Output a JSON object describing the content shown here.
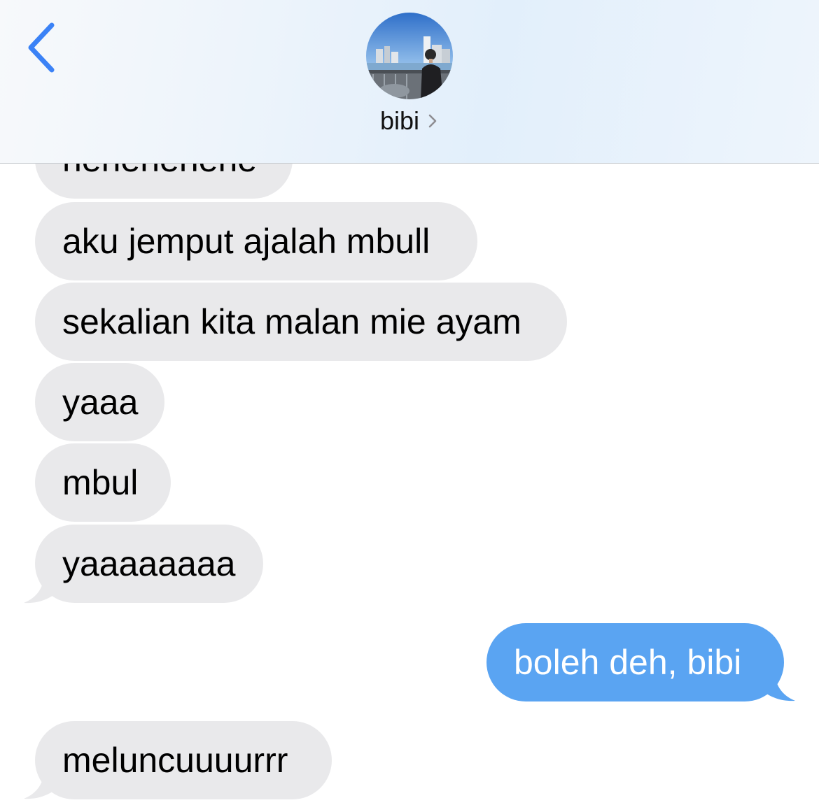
{
  "conversation": {
    "contact_name": "bibi",
    "back_icon": "chevron-left-icon",
    "contact_chevron_icon": "chevron-right-icon",
    "accent_color": "#3b82f6",
    "messages": [
      {
        "from": "them",
        "text": "hehehehehe"
      },
      {
        "from": "them",
        "text": "aku jemput ajalah mbull"
      },
      {
        "from": "them",
        "text": "sekalian kita malan mie ayam"
      },
      {
        "from": "them",
        "text": "yaaa"
      },
      {
        "from": "them",
        "text": "mbul"
      },
      {
        "from": "them",
        "text": "yaaaaaaaa"
      },
      {
        "from": "me",
        "text": "boleh deh, bibi"
      },
      {
        "from": "them",
        "text": "meluncuuuurrr"
      }
    ]
  },
  "colors": {
    "received_bubble": "#e9e9eb",
    "sent_bubble": "#5aa4f2"
  }
}
